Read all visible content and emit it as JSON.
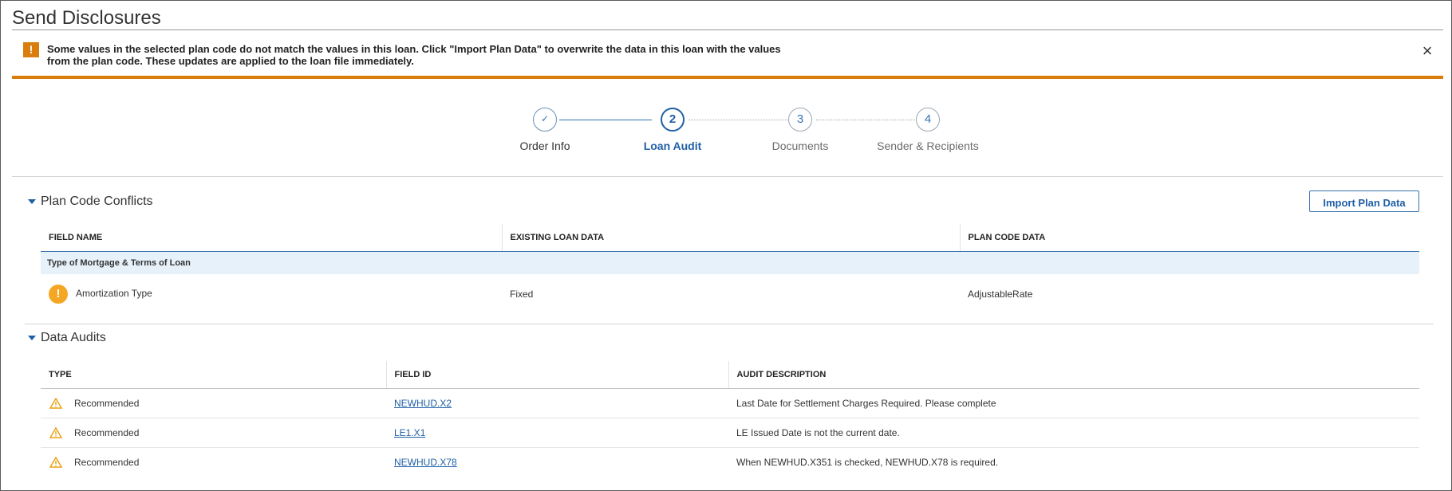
{
  "title": "Send Disclosures",
  "alert": {
    "icon": "alert-icon",
    "message": "Some values in the selected plan code do not match the values in this loan. Click \"Import Plan Data\" to overwrite the data in this loan with the values from the plan code. These updates are applied to the loan file immediately.",
    "close": "×"
  },
  "steps": [
    {
      "marker": "✓",
      "label": "Order Info",
      "state": "done"
    },
    {
      "marker": "2",
      "label": "Loan Audit",
      "state": "active"
    },
    {
      "marker": "3",
      "label": "Documents",
      "state": "todo"
    },
    {
      "marker": "4",
      "label": "Sender & Recipients",
      "state": "todo"
    }
  ],
  "plan_code": {
    "heading": "Plan Code Conflicts",
    "import_button": "Import Plan Data",
    "columns": [
      "FIELD NAME",
      "EXISTING LOAN DATA",
      "PLAN CODE DATA"
    ],
    "group": "Type of Mortgage & Terms of Loan",
    "rows": [
      {
        "icon": "!",
        "field": "Amortization Type",
        "existing": "Fixed",
        "plan": "AdjustableRate"
      }
    ]
  },
  "data_audits": {
    "heading": "Data Audits",
    "columns": [
      "TYPE",
      "FIELD ID",
      "AUDIT DESCRIPTION"
    ],
    "rows": [
      {
        "type": "Recommended",
        "field_id": "NEWHUD.X2",
        "description": "Last Date for Settlement Charges Required. Please complete"
      },
      {
        "type": "Recommended",
        "field_id": "LE1.X1",
        "description": "LE Issued Date is not the current date."
      },
      {
        "type": "Recommended",
        "field_id": "NEWHUD.X78",
        "description": "When NEWHUD.X351 is checked, NEWHUD.X78 is required."
      }
    ]
  },
  "colors": {
    "accent": "#1f5fa6",
    "warning": "#d97d0d",
    "warning_icon": "#f5a623"
  }
}
